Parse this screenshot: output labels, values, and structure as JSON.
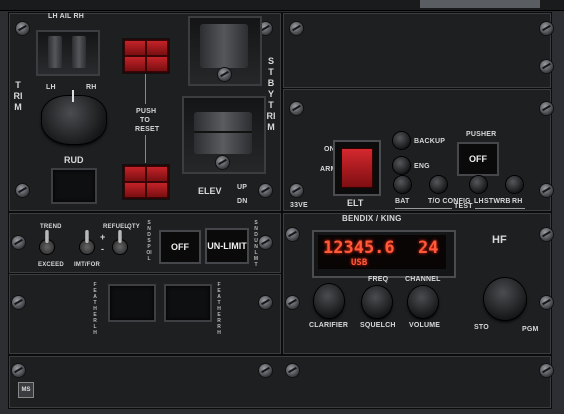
{
  "trim_panel": {
    "trim_vertical": "TRIM",
    "aileron_labels": "LH AIL RH",
    "rud_lh": "LH",
    "rud_rh": "RH",
    "rud_label": "RUD",
    "push_to_reset": [
      "PUSH",
      "TO",
      "RESET"
    ],
    "elev_label": "ELEV",
    "up_label": "UP",
    "dn_label": "DN",
    "stby_trim_vertical": "STBY TRIM"
  },
  "elt_panel": {
    "on_label": "ON",
    "arm_label": "ARM",
    "elt_label": "ELT",
    "volts_label": "33VE",
    "backup_label": "BACKUP",
    "eng_label": "ENG",
    "pusher_label": "PUSHER",
    "pusher_state": "OFF",
    "test_label": "TEST",
    "bat_label": "BAT",
    "to_config_label": "T/O CONFIG",
    "lh_label": "LH",
    "stwrb_label": "STWRB",
    "rh_label": "RH"
  },
  "fuel_panel": {
    "trend": "TREND",
    "refuel": "REFUEL",
    "qty": "QTY",
    "plus": "+",
    "minus": "-",
    "exceed": "EXCEED",
    "imt_for": "IMT/FOR",
    "sync_label_left": "SND SPOIL",
    "off_button": "OFF",
    "unlimit_button": "UN-LIMIT",
    "sync_label_right": "SND UNLMT",
    "feather_lh": "FEATHER LH",
    "feather_rh": "FEATHER RH"
  },
  "hf_radio": {
    "brand": "BENDIX / KING",
    "hf_label": "HF",
    "frequency": "12345.6",
    "channel": "24",
    "mode": "USB",
    "freq_label": "FREQ",
    "channel_label": "CHANNEL",
    "clarifier_label": "CLARIFIER",
    "squelch_label": "SQUELCH",
    "volume_label": "VOLUME",
    "sto_label": "STO",
    "pgm_label": "PGM"
  },
  "footer": {
    "logo_text": "MS"
  }
}
